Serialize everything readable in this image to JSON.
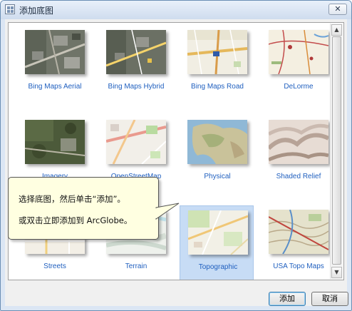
{
  "window": {
    "title": "添加底图",
    "close_symbol": "✕"
  },
  "gallery": {
    "items": [
      {
        "label": "Bing Maps Aerial",
        "icon": "bing-maps-aerial-thumbnail",
        "selected": false
      },
      {
        "label": "Bing Maps Hybrid",
        "icon": "bing-maps-hybrid-thumbnail",
        "selected": false
      },
      {
        "label": "Bing Maps Road",
        "icon": "bing-maps-road-thumbnail",
        "selected": false
      },
      {
        "label": "DeLorme",
        "icon": "delorme-thumbnail",
        "selected": false
      },
      {
        "label": "Imagery",
        "icon": "imagery-thumbnail",
        "selected": false
      },
      {
        "label": "OpenStreetMap",
        "icon": "openstreetmap-thumbnail",
        "selected": false
      },
      {
        "label": "Physical",
        "icon": "physical-thumbnail",
        "selected": false
      },
      {
        "label": "Shaded Relief",
        "icon": "shaded-relief-thumbnail",
        "selected": false
      },
      {
        "label": "Streets",
        "icon": "streets-thumbnail",
        "selected": false
      },
      {
        "label": "Terrain",
        "icon": "terrain-thumbnail",
        "selected": false
      },
      {
        "label": "Topographic",
        "icon": "topographic-thumbnail",
        "selected": true
      },
      {
        "label": "USA Topo Maps",
        "icon": "usa-topo-maps-thumbnail",
        "selected": false
      }
    ]
  },
  "tooltip": {
    "line1": "选择底图，然后单击“添加”。",
    "line2": "或双击立即添加到 ArcGlobe。"
  },
  "buttons": {
    "add": "添加",
    "cancel": "取消"
  },
  "colors": {
    "label_link": "#1f5fbf",
    "selection": "#c7dcf5",
    "tooltip_bg": "#ffffe1"
  }
}
